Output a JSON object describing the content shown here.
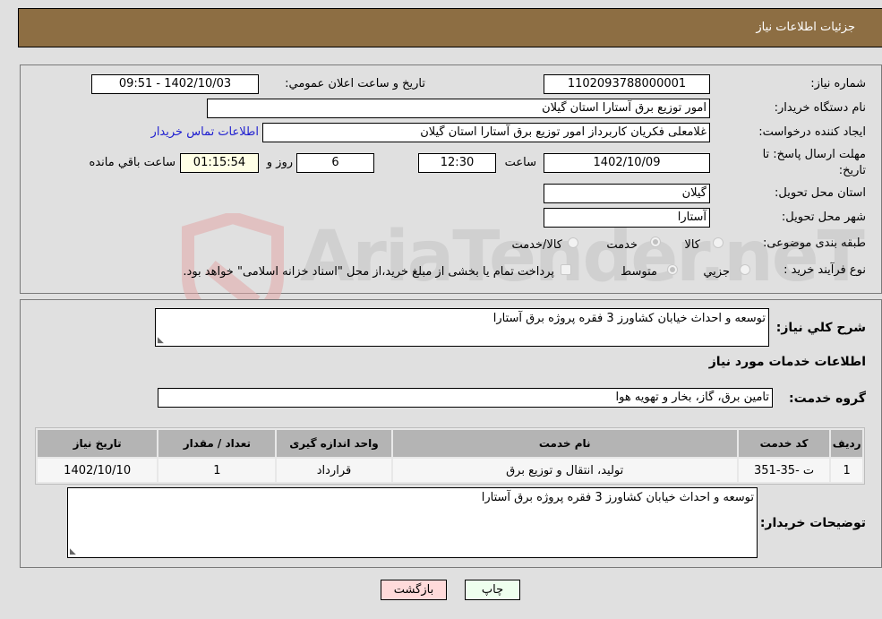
{
  "header": {
    "title": "جزئیات اطلاعات نیاز"
  },
  "watermark": {
    "text": "AriaTender.neT"
  },
  "form": {
    "need_number_label": "شماره نیاز:",
    "need_number": "1102093788000001",
    "announce_label": "تاریخ و ساعت اعلان عمومي:",
    "announce_value": "1402/10/03 - 09:51",
    "buyer_org_label": "نام دستگاه خریدار:",
    "buyer_org": "امور توزیع برق آستارا استان گیلان",
    "requester_label": "ایجاد کننده درخواست:",
    "requester": "غلامعلی فکریان کاربرداز امور توزیع برق آستارا استان گیلان",
    "contact_link": "اطلاعات تماس خریدار",
    "deadline_label_1": "مهلت ارسال پاسخ: تا",
    "deadline_label_2": "تاریخ:",
    "deadline_date": "1402/10/09",
    "time_label": "ساعت",
    "deadline_time": "12:30",
    "days_value": "6",
    "days_label": "روز و",
    "remaining_time": "01:15:54",
    "remaining_label": "ساعت باقي مانده",
    "province_label": "استان محل تحویل:",
    "province": "گیلان",
    "city_label": "شهر محل تحویل:",
    "city": "آستارا",
    "category_label": "طبقه بندی موضوعی:",
    "category_options": [
      {
        "label": "کالا",
        "selected": false
      },
      {
        "label": "خدمت",
        "selected": true
      },
      {
        "label": "کالا/خدمت",
        "selected": false
      }
    ],
    "process_label": "نوع فرآیند خرید :",
    "process_options": [
      {
        "label": "جزيي",
        "selected": false
      },
      {
        "label": "متوسط",
        "selected": true
      }
    ],
    "treasury_note": "پرداخت تمام یا بخشی از مبلغ خرید،از محل \"اسناد خزانه اسلامی\" خواهد بود.",
    "treasury_checked": false
  },
  "details": {
    "summary_label": "شرح کلي نیاز:",
    "summary": "توسعه و احداث خیابان کشاورز 3 فقره پروژه برق آستارا",
    "services_heading": "اطلاعات خدمات مورد نیاز",
    "service_group_label": "گروه خدمت:",
    "service_group": "تامین برق، گاز، بخار و تهویه هوا",
    "table": {
      "headers": [
        "ردیف",
        "کد خدمت",
        "نام خدمت",
        "واحد اندازه گیری",
        "تعداد / مقدار",
        "تاریخ نیاز"
      ],
      "rows": [
        [
          "1",
          "ت -35-351",
          "تولید، انتقال و توزیع برق",
          "قرارداد",
          "1",
          "1402/10/10"
        ]
      ]
    },
    "buyer_notes_label": "توضیحات خریدار:",
    "buyer_notes": "توسعه و احداث خیابان کشاورز 3 فقره پروژه برق آستارا"
  },
  "buttons": {
    "print": "چاپ",
    "back": "بازگشت"
  },
  "colors": {
    "header_bg": "#8d6e43",
    "link": "#2020d0",
    "back_btn": "#ffdada",
    "print_btn": "#eeffee"
  }
}
